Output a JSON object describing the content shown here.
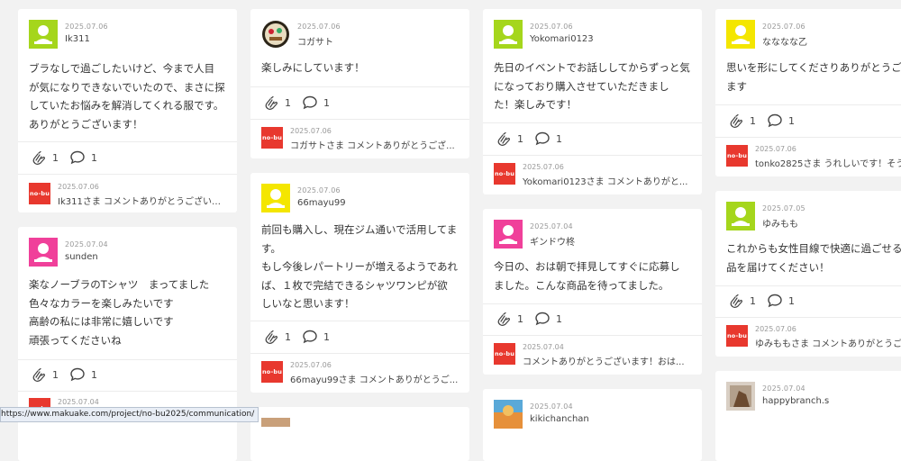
{
  "reply_logo_text": "no-bu",
  "reaction_icons": {
    "clap": "clap-icon",
    "comment": "speech-bubble-icon"
  },
  "colors": {
    "green": "#a5d61c",
    "pink": "#f0409a",
    "yellow": "#f4e600",
    "brand_red": "#e8382e"
  },
  "status_url": "https://www.makuake.com/project/no-bu2025/communication/",
  "cards": [
    {
      "date": "2025.07.06",
      "user": "Ik311",
      "avatar": "green",
      "lines": [
        "ブラなしで過ごしたいけど、今まで人目",
        "が気になりできないでいたので、まさに探",
        "していたお悩みを解消してくれる服です。",
        "ありがとうございます！"
      ],
      "claps": "1",
      "comments": "1",
      "reply_date": "2025.07.06",
      "reply": "Ik311さま コメントありがとうございま..."
    },
    {
      "date": "2025.07.04",
      "user": "sunden",
      "avatar": "pink",
      "lines": [
        "楽なノーブラのTシャツ　まってました",
        "色々なカラーを楽しみたいです",
        "高齢の私には非常に嬉しいです",
        "頑張ってくださいね"
      ],
      "claps": "1",
      "comments": "1",
      "reply_date": "2025.07.04",
      "reply": ""
    },
    {
      "date": "2025.07.06",
      "user": "コガサト",
      "avatar": "photo-round",
      "lines": [
        "楽しみにしています！"
      ],
      "claps": "1",
      "comments": "1",
      "reply_date": "2025.07.06",
      "reply": "コガサトさま コメントありがとうござ..."
    },
    {
      "date": "2025.07.06",
      "user": "66mayu99",
      "avatar": "yellow",
      "lines": [
        "前回も購入し、現在ジム通いで活用してま",
        "す。",
        "もし今後レパートリーが増えるようであれ",
        "ば、１枚で完結できるシャツワンピが欲",
        "しいなと思います！"
      ],
      "claps": "1",
      "comments": "1",
      "reply_date": "2025.07.06",
      "reply": "66mayu99さま コメントありがとうご..."
    },
    {
      "date": "2025.07.06",
      "user": "Yokomari0123",
      "avatar": "green",
      "lines": [
        "先日のイベントでお話ししてからずっと気",
        "になっており購入させていただきまし",
        "た！楽しみです！"
      ],
      "claps": "1",
      "comments": "1",
      "reply_date": "2025.07.06",
      "reply": "Yokomari0123さま コメントありがと..."
    },
    {
      "date": "2025.07.04",
      "user": "ギンドウ柊",
      "avatar": "pink",
      "lines": [
        "今日の、おは朝で拝見してすぐに応募し",
        "ました。こんな商品を待ってました。"
      ],
      "claps": "1",
      "comments": "1",
      "reply_date": "2025.07.04",
      "reply": "コメントありがとうございます！おは..."
    },
    {
      "date": "2025.07.04",
      "user": "kikichanchan",
      "avatar": "photo-orange",
      "lines": [],
      "claps": "",
      "comments": "",
      "reply_date": "",
      "reply": ""
    },
    {
      "date": "2025.07.06",
      "user": "なななな乙",
      "avatar": "yellow",
      "lines": [
        "思いを形にしてくださりありがとうご",
        "ます"
      ],
      "claps": "1",
      "comments": "1",
      "reply_date": "2025.07.06",
      "reply": "tonko2825さま うれしいです！そう"
    },
    {
      "date": "2025.07.05",
      "user": "ゆみもも",
      "avatar": "green",
      "lines": [
        "これからも女性目線で快適に過ごせる",
        "品を届けてください！"
      ],
      "claps": "1",
      "comments": "1",
      "reply_date": "2025.07.06",
      "reply": "ゆみももさま コメントありがとうご"
    },
    {
      "date": "2025.07.04",
      "user": "happybranch.s",
      "avatar": "photo-brown",
      "lines": [],
      "claps": "",
      "comments": "",
      "reply_date": "",
      "reply": ""
    }
  ]
}
